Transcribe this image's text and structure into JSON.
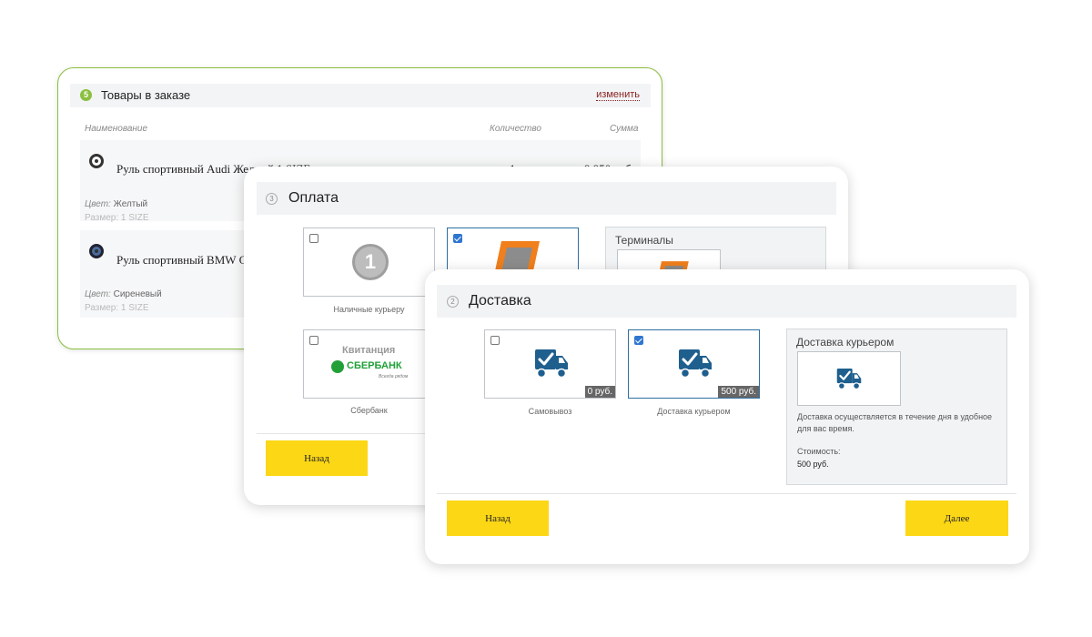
{
  "order": {
    "step": "5",
    "title": "Товары в заказе",
    "edit_link": "изменить",
    "columns": {
      "name": "Наименование",
      "qty": "Количество",
      "sum": "Сумма"
    },
    "items": [
      {
        "name": "Руль спортивный Audi Желтый 1 SIZE",
        "color_label": "Цвет:",
        "color": "Желтый",
        "size": "Размер: 1 SIZE",
        "qty": "1",
        "sum": "9 950 руб."
      },
      {
        "name": "Руль спортивный BMW Сиреневый",
        "color_label": "Цвет:",
        "color": "Сиреневый",
        "size": "Размер: 1 SIZE"
      }
    ]
  },
  "payment": {
    "step": "3",
    "title": "Оплата",
    "options": [
      {
        "label": "Наличные курьеру",
        "checked": false
      },
      {
        "label": "Терминалы",
        "checked": true
      },
      {
        "label": "Сбербанк",
        "checked": false,
        "logo_top": "Квитанция",
        "logo_bottom": "СБЕРБАНК",
        "logo_tagline": "Всегда рядом"
      }
    ],
    "panel_title": "Терминалы",
    "back_label": "Назад"
  },
  "delivery": {
    "step": "2",
    "title": "Доставка",
    "options": [
      {
        "label": "Самовывоз",
        "price": "0 руб.",
        "checked": false
      },
      {
        "label": "Доставка курьером",
        "price": "500 руб.",
        "checked": true
      }
    ],
    "panel": {
      "title": "Доставка курьером",
      "description": "Доставка осуществляется в течение дня в удобное для вас время.",
      "cost_label": "Стоимость:",
      "cost_value": "500 руб."
    },
    "back_label": "Назад",
    "next_label": "Далее"
  },
  "colors": {
    "accent_green": "#8bbf3f",
    "button_yellow": "#fcd716",
    "truck_blue": "#1e5f8e"
  }
}
